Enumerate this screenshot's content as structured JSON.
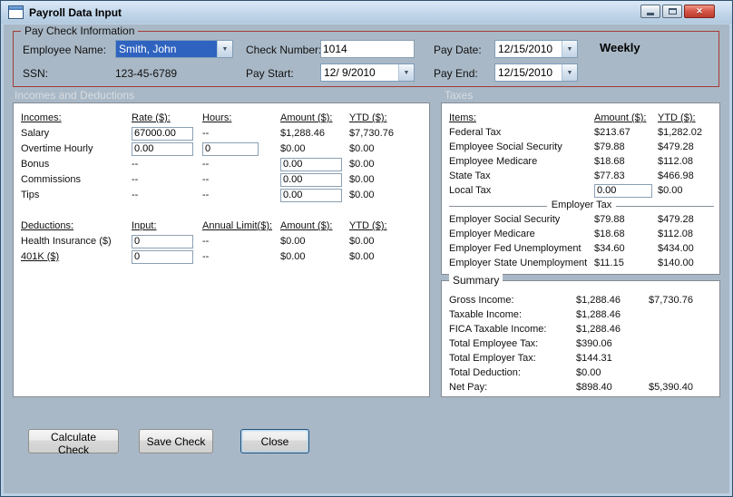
{
  "window": {
    "title": "Payroll Data Input"
  },
  "titlebar_icons": {
    "close_glyph": "✕"
  },
  "colors": {
    "dialog_bg": "#a9b8c6",
    "paycheck_border": "#a23c36",
    "selection_blue": "#2f63c0",
    "close_button_red": "#c5483a",
    "panel_bg": "#ffffff",
    "section_label_text": "#d9dde1"
  },
  "sections": {
    "incomes_and_deductions": "Incomes and Deductions",
    "taxes": "Taxes"
  },
  "paycheck": {
    "group_label": "Pay Check Information",
    "employee_name": {
      "label": "Employee Name:",
      "value": "Smith, John"
    },
    "ssn": {
      "label": "SSN:",
      "value": "123-45-6789"
    },
    "check_number": {
      "label": "Check Number:",
      "value": "1014"
    },
    "pay_start": {
      "label": "Pay Start:",
      "value": "12/ 9/2010"
    },
    "pay_date": {
      "label": "Pay Date:",
      "value": "12/15/2010"
    },
    "pay_end": {
      "label": "Pay End:",
      "value": "12/15/2010"
    },
    "frequency": "Weekly"
  },
  "incomes": {
    "header_label": "Incomes:",
    "header_rate": "Rate ($):",
    "header_hours": "Hours:",
    "header_amount": "Amount ($):",
    "header_ytd": "YTD ($):",
    "salary": {
      "label": "Salary",
      "rate": "67000.00",
      "hours": "--",
      "amount": "$1,288.46",
      "ytd": "$7,730.76"
    },
    "overtime": {
      "label": "Overtime Hourly",
      "rate": "0.00",
      "hours": "0",
      "amount": "$0.00",
      "ytd": "$0.00"
    },
    "bonus": {
      "label": "Bonus",
      "rate": "--",
      "hours": "--",
      "amount": "0.00",
      "ytd": "$0.00"
    },
    "commissions": {
      "label": "Commissions",
      "rate": "--",
      "hours": "--",
      "amount": "0.00",
      "ytd": "$0.00"
    },
    "tips": {
      "label": "Tips",
      "rate": "--",
      "hours": "--",
      "amount": "0.00",
      "ytd": "$0.00"
    }
  },
  "deductions": {
    "header_label": "Deductions:",
    "header_input": "Input:",
    "header_limit": "Annual Limit($):",
    "header_amount": "Amount ($):",
    "header_ytd": "YTD ($):",
    "health_insurance": {
      "label": "Health Insurance  ($)",
      "input": "0",
      "limit": "--",
      "amount": "$0.00",
      "ytd": "$0.00"
    },
    "k401": {
      "label": "401K  ($)",
      "input": "0",
      "limit": "--",
      "amount": "$0.00",
      "ytd": "$0.00"
    }
  },
  "taxes": {
    "header_items": "Items:",
    "header_amount": "Amount ($):",
    "header_ytd": "YTD ($):",
    "federal": {
      "label": "Federal Tax",
      "amount": "$213.67",
      "ytd": "$1,282.02"
    },
    "employee_ss": {
      "label": "Employee Social Security",
      "amount": "$79.88",
      "ytd": "$479.28"
    },
    "employee_medicare": {
      "label": "Employee Medicare",
      "amount": "$18.68",
      "ytd": "$112.08"
    },
    "state": {
      "label": "State Tax",
      "amount": "$77.83",
      "ytd": "$466.98"
    },
    "local": {
      "label": "Local Tax",
      "input": "0.00",
      "ytd": "$0.00"
    },
    "employer_header": "Employer Tax",
    "employer_ss": {
      "label": "Employer Social Security",
      "amount": "$79.88",
      "ytd": "$479.28"
    },
    "employer_medicare": {
      "label": "Employer Medicare",
      "amount": "$18.68",
      "ytd": "$112.08"
    },
    "employer_fed_unemployment": {
      "label": "Employer Fed Unemployment",
      "amount": "$34.60",
      "ytd": "$434.00"
    },
    "employer_state_unemployment": {
      "label": "Employer State Unemployment",
      "amount": "$11.15",
      "ytd": "$140.00"
    }
  },
  "summary": {
    "group_label": "Summary",
    "gross": {
      "label": "Gross Income:",
      "amount": "$1,288.46",
      "ytd": "$7,730.76"
    },
    "taxable": {
      "label": "Taxable Income:",
      "amount": "$1,288.46"
    },
    "fica": {
      "label": "FICA Taxable Income:",
      "amount": "$1,288.46"
    },
    "total_employee_tax": {
      "label": "Total Employee Tax:",
      "amount": "$390.06"
    },
    "total_employer_tax": {
      "label": "Total Employer Tax:",
      "amount": "$144.31"
    },
    "total_deduction": {
      "label": "Total Deduction:",
      "amount": "$0.00"
    },
    "net_pay": {
      "label": "Net Pay:",
      "amount": "$898.40",
      "ytd": "$5,390.40"
    }
  },
  "buttons": {
    "calculate": "Calculate Check",
    "save": "Save Check",
    "close": "Close"
  }
}
